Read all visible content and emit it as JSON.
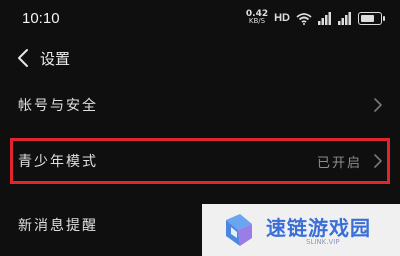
{
  "status_bar": {
    "time": "10:10",
    "net_speed_value": "0.42",
    "net_speed_unit": "KB/S",
    "hd_label": "HD",
    "icons": [
      "wifi-icon",
      "signal-icon",
      "signal-icon",
      "battery-icon"
    ],
    "battery_level": 0.8
  },
  "header": {
    "back_icon": "chevron-left-icon",
    "title": "设置"
  },
  "settings": {
    "items": [
      {
        "label": "帐号与安全",
        "value": "",
        "icon": "chevron-right-icon"
      },
      {
        "label": "青少年模式",
        "value": "已开启",
        "icon": "chevron-right-icon"
      },
      {
        "label": "新消息提醒",
        "value": "",
        "icon": "chevron-right-icon"
      }
    ]
  },
  "watermark": {
    "brand": "速链游戏园",
    "url": "SLINK.VIP",
    "icon": "logo-icon"
  },
  "colors": {
    "background": "#0f0f10",
    "highlight_border": "#e0262c",
    "watermark_text": "#3a6fd8"
  }
}
